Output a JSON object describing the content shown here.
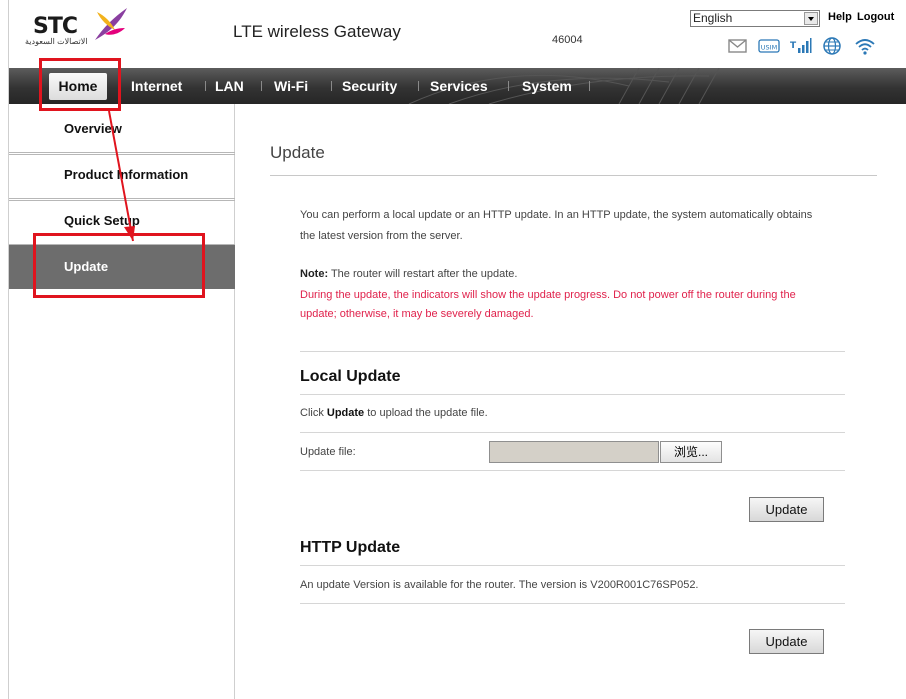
{
  "header": {
    "logo_text": "STC",
    "logo_arabic": "الاتصالات السعودية",
    "app_title": "LTE wireless Gateway",
    "network_code": "46004",
    "language_selected": "English",
    "help_label": "Help",
    "logout_label": "Logout",
    "status_icons": [
      "mail-icon",
      "usim-icon",
      "signal-icon",
      "globe-icon",
      "wifi-icon"
    ],
    "usim_text": "USIM"
  },
  "nav": {
    "items": [
      "Home",
      "Internet",
      "LAN",
      "Wi-Fi",
      "Security",
      "Services",
      "System"
    ],
    "active": "Home"
  },
  "sidebar": {
    "items": [
      "Overview",
      "Product Information",
      "Quick Setup",
      "Update"
    ],
    "active": "Update"
  },
  "main": {
    "title": "Update",
    "intro_line1": "You can perform a local update or an HTTP update. In an HTTP update, the system automatically obtains",
    "intro_line2": "the latest version from the server.",
    "note_label": "Note:",
    "note_text": " The router will restart after the update.",
    "warning_line1": "During the update, the indicators will show the update progress. Do not power off the router during the",
    "warning_line2": "update; otherwise, it may be severely damaged.",
    "local_update": {
      "heading": "Local Update",
      "instruction_pre": "Click ",
      "instruction_bold": "Update",
      "instruction_post": " to upload the update file.",
      "file_label": "Update file:",
      "file_value": "",
      "browse_label": "浏览...",
      "button_label": "Update"
    },
    "http_update": {
      "heading": "HTTP Update",
      "message": "An update Version is available for the router. The version is V200R001C76SP052.",
      "button_label": "Update"
    }
  },
  "colors": {
    "nav_bg": "#333333",
    "sidebar_active_bg": "#6d6d6d",
    "warning_text": "#e0224c",
    "annotation": "#e0141e"
  }
}
